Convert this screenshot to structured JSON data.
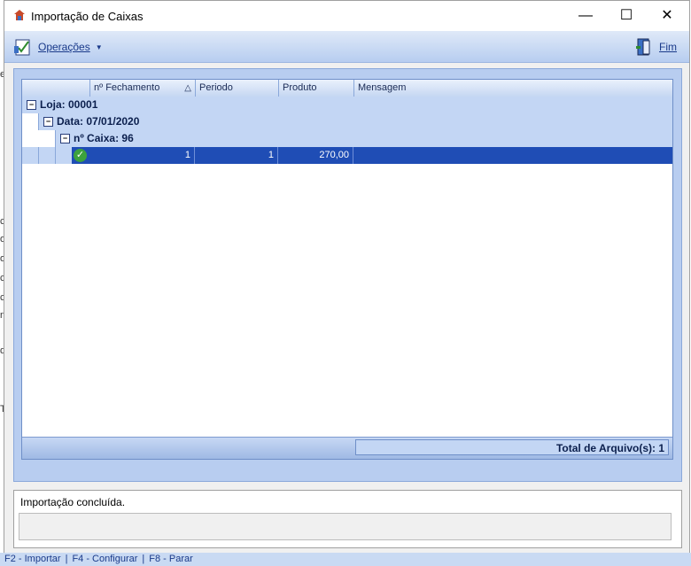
{
  "window": {
    "title": "Importação de Caixas",
    "controls": {
      "minimize": "—",
      "maximize": "☐",
      "close": "✕"
    }
  },
  "toolbar": {
    "operations_label": "Operações",
    "operations_caret": "▼",
    "exit_label": "Fim"
  },
  "grid": {
    "columns": [
      "nº Fechamento",
      "Periodo",
      "Produto",
      "Mensagem"
    ],
    "sort_indicator": "△",
    "groups": {
      "store": "Loja: 00001",
      "date": "Data: 07/01/2020",
      "register": "nº Caixa: 96"
    },
    "row": {
      "fechamento": "1",
      "periodo": "1",
      "produto": "270,00",
      "mensagem": ""
    },
    "total_label": "Total de Arquivo(s): 1"
  },
  "status": {
    "message": "Importação concluída."
  },
  "shortcuts": [
    "F2 - Importar",
    "F4 - Configurar",
    "F8 - Parar"
  ],
  "colors": {
    "selection": "#1f4db5",
    "group_row": "#c3d6f4",
    "toolbar": "#b7cdf0"
  },
  "icons": [
    "app-icon",
    "operations-icon",
    "exit-door-icon",
    "check-icon",
    "collapse-icon"
  ]
}
